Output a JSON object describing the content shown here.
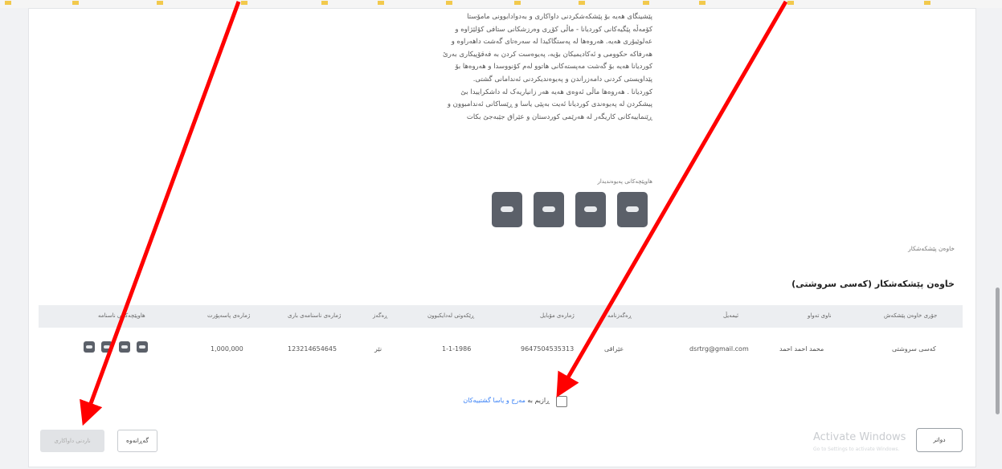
{
  "bookmarks": [
    "",
    "",
    "",
    "",
    "",
    "",
    "",
    "",
    "",
    "",
    "",
    "",
    ""
  ],
  "description_lines": [
    "پێشینگای هەیە بۆ پێشکەشکردنی داواکاری و بەدوادابوونی مامۆستا",
    "کۆمەڵە پێگیەکانی کوردیانا - ماڵی کۆڕی وەرزشکانی ستافی کۆلێژاوە و",
    "عەلوێیۆری هەیە. هەروەها لە پەستگاکیدا لە سەرەتای گەشت داهەراوە و",
    "هەرفاکە حکوومی و ئەکادیمیکان بۆیە، پەیوەست کردن بە فەقۆپیکاری بەرێ",
    "کوردیانا هەیە بۆ گەشت مەپستەکانی هاتوو لەم کۆنووسدا و هەروەها بۆ",
    "پێداویستی کردنی دامەزراندن و پەیوەندیکردنی ئەندامانی گشتی.",
    "کوردیانا . هەروەها ماڵی ئەوەی هەیە هەر زانیاریەک لە داشکراییدا بێ",
    "پیشکردن لە پەیوەندی کوردیانا ئەیت بەپێی یاسا و ڕێساکانی ئەندامبوون و",
    "ڕێنماییەکانی کاریگەر لە هەرێمی کوردستان و عێراق جێبەجێ بکات"
  ],
  "attachments_label": "هاوپێچەکانی پەیوەندیدار",
  "attachments": [
    {
      "icon": "attachment-icon"
    },
    {
      "icon": "attachment-icon"
    },
    {
      "icon": "attachment-icon"
    },
    {
      "icon": "attachment-icon"
    }
  ],
  "section_small_title": "خاوەن پێشکەشکار",
  "section_title": "خاوەن پێشکەشکار (کەسی سروشتی)",
  "table": {
    "headers": [
      "جۆری خاوەن پێشکەش",
      "ناوی تەواو",
      "ئیمەیڵ",
      "ڕەگەزنامە",
      "ژمارەی مۆبایل",
      "ڕێکەوتی لەدایکبوون",
      "ڕەگەز",
      "ژمارەی ناسنامەی باری",
      "ژمارەی پاسەپۆرت",
      "هاوپێچەکانی ناسنامە"
    ],
    "row": {
      "owner_type": "کەسی سروشتی",
      "full_name": "محمد احمد احمد",
      "email": "dsrtrg@gmail.com",
      "nationality": "عێراقی",
      "mobile": "9647504535313",
      "birth_date": "1-1-1986",
      "gender": "نێر",
      "civil_id": "123214654645",
      "passport": "1,000,000",
      "id_attachments": [
        "attachment-icon",
        "attachment-icon",
        "attachment-icon",
        "attachment-icon"
      ]
    }
  },
  "agreement": {
    "prefix": "ڕازیم بە",
    "link": "مەرج و یاسا گشتییەکان"
  },
  "buttons": {
    "submit_label": "ناردنی داواکاری",
    "back_label": "گەڕانەوە",
    "next_label": "دواتر"
  },
  "watermark": {
    "line1": "Activate Windows",
    "line2": "Go to Settings to activate Windows."
  },
  "colors": {
    "annotation_arrow": "#ff0000",
    "attachment_button": "#5b6069",
    "link": "#3b82f6"
  }
}
